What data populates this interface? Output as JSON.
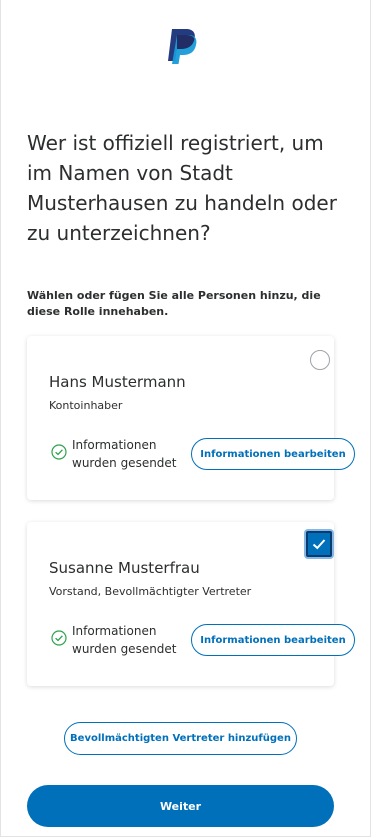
{
  "header": {
    "logo_icon": "paypal-logo-icon"
  },
  "question": {
    "title": "Wer ist offiziell registriert, um im Namen von Stadt Musterhausen zu handeln oder zu unterzeichnen?",
    "instruction": "Wählen oder fügen Sie alle Personen hinzu, die diese Rolle innehaben."
  },
  "people": [
    {
      "name": "Hans Mustermann",
      "role": "Kontoinhaber",
      "selected": false,
      "status": "Informationen wurden gesendet",
      "status_icon": "check-circle-icon",
      "edit_label": "Informationen bearbeiten"
    },
    {
      "name": "Susanne Musterfrau",
      "role": "Vorstand, Bevollmächtigter Vertreter",
      "selected": true,
      "status": "Informationen wurden gesendet",
      "status_icon": "check-circle-icon",
      "edit_label": "Informationen bearbeiten"
    }
  ],
  "actions": {
    "add_label": "Bevollmächtigten Vertreter hinzufügen",
    "next_label": "Weiter"
  },
  "colors": {
    "primary": "#0070ba",
    "success": "#2ca24b",
    "text": "#2c2e2f"
  }
}
